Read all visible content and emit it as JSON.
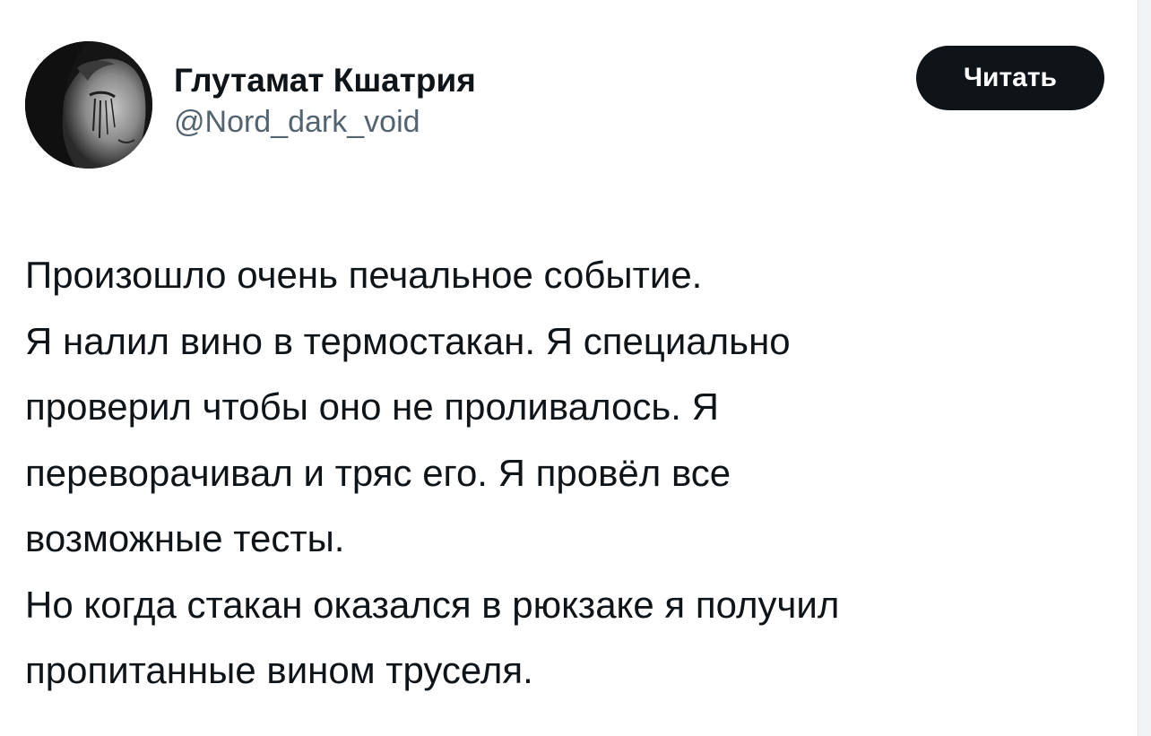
{
  "author": {
    "display_name": "Глутамат Кшатрия",
    "handle": "@Nord_dark_void",
    "avatar_icon": "dark-portrait-avatar"
  },
  "actions": {
    "follow_label": "Читать"
  },
  "tweet": {
    "lines": [
      "Произошло очень печальное событие.",
      "Я налил вино в термостакан. Я специально",
      "проверил чтобы оно не проливалось. Я",
      "переворачивал и тряс его. Я провёл все",
      "возможные тесты.",
      "Но когда стакан оказался в рюкзаке я получил",
      "пропитанные вином труселя."
    ]
  },
  "colors": {
    "text_primary": "#0f1419",
    "text_secondary": "#536471",
    "button_bg": "#0f1419",
    "button_text": "#ffffff",
    "background": "#ffffff"
  }
}
